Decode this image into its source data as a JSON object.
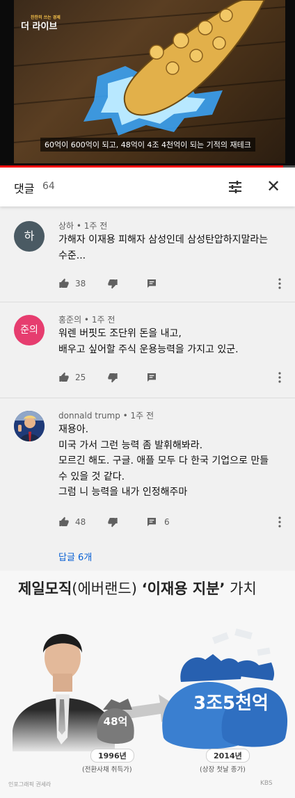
{
  "video": {
    "channel_logo_top": "찬찬히 쓰는 경제",
    "channel_logo": "더 라이브",
    "caption": "60억이 600억이 되고, 48억이 4조 4천억이 되는 기적의 재테크",
    "progress": 0.96
  },
  "comments_header": {
    "title": "댓글",
    "count": "64",
    "filter_icon": "sliders-icon",
    "close_icon": "close-icon"
  },
  "comments": [
    {
      "avatar_text": "하",
      "avatar_color": "#4a5a63",
      "author": "상하 • 1주 전",
      "lines": [
        "가해자 이재용 피해자 삼성인데 삼성탄압하지말라는",
        "수준..."
      ],
      "likes": "38"
    },
    {
      "avatar_text": "준의",
      "avatar_color": "#e63d6f",
      "author": "홍준의 • 1주 전",
      "lines": [
        "워렌 버핏도 조단위 돈을 내고,",
        "배우고 싶어할 주식 운용능력을 가지고 있군."
      ],
      "likes": "25"
    },
    {
      "avatar_text": "",
      "avatar_color": "#2b4a8a",
      "author": "donnald trump • 1주 전",
      "lines": [
        "재용아.",
        "미국 가서 그런 능력 좀 발휘해봐라.",
        "모르긴 해도. 구글. 애플 모두 다 한국 기업으로 만들",
        "수 있을 것 같다.",
        "그럼 니 능력을 내가 인정해주마"
      ],
      "likes": "48",
      "reply_count": "6",
      "view_replies": "답글 6개"
    }
  ],
  "infographic": {
    "headline_a": "제일모직",
    "headline_b": "(에버랜드) ",
    "headline_c": "‘이재용 지분’",
    "headline_d": " 가치",
    "bag_small_label": "48억",
    "bag_big_label": "3조5천억",
    "year_1": "1996년",
    "note_1": "(전환사채 취득가)",
    "year_2": "2014년",
    "note_2": "(상장 첫날 종가)",
    "credit": "인포그래픽 권세라",
    "watermark": "KBS",
    "bag_color": "#2f6fc1"
  }
}
